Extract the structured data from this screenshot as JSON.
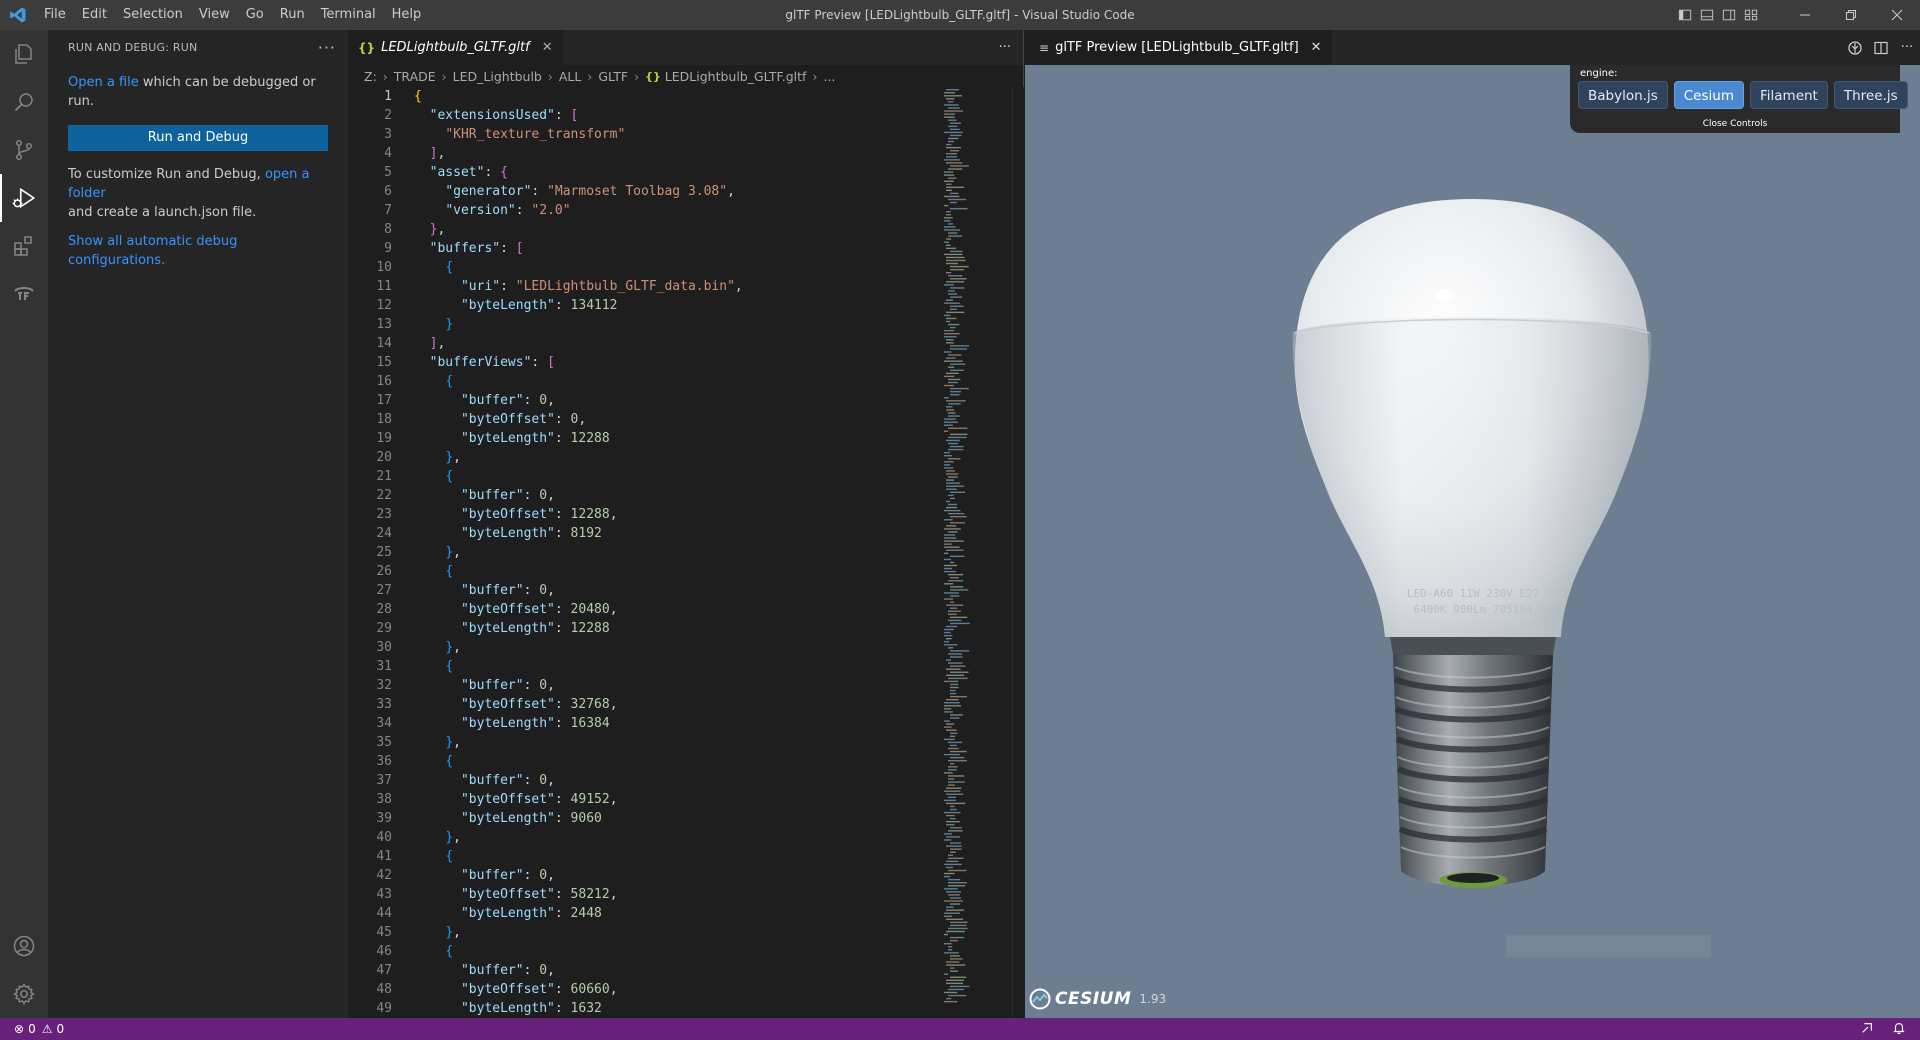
{
  "window": {
    "title": "glTF Preview [LEDLightbulb_GLTF.gltf] - Visual Studio Code"
  },
  "menu": [
    "File",
    "Edit",
    "Selection",
    "View",
    "Go",
    "Run",
    "Terminal",
    "Help"
  ],
  "sidebar": {
    "header": "RUN AND DEBUG: RUN",
    "open_file_link": "Open a file",
    "open_file_text": " which can be debugged or run.",
    "run_button": "Run and Debug",
    "customize_text": "To customize Run and Debug, ",
    "open_folder_link": "open a folder",
    "launch_text": "and create a launch.json file.",
    "show_all_link": "Show all automatic debug configurations."
  },
  "editor": {
    "tab_label": "LEDLightbulb_GLTF.gltf",
    "tab_icon": "{}",
    "breadcrumb": [
      "Z:",
      "TRADE",
      "LED_Lightbulb",
      "ALL",
      "GLTF",
      "LEDLightbulb_GLTF.gltf",
      "..."
    ],
    "current_line": 1
  },
  "preview": {
    "tab_label": "glTF Preview [LEDLightbulb_GLTF.gltf]",
    "engine_label": "engine:",
    "engines": [
      "Babylon.js",
      "Cesium",
      "Filament",
      "Three.js"
    ],
    "active_engine": "Cesium",
    "close_controls": "Close Controls",
    "cesium_word": "CESIUM",
    "cesium_version": "1.93",
    "bulb_text_line1": "LED-A60 11W 230V E27",
    "bulb_text_line2": "6400K 900Lm 705104"
  },
  "statusbar": {
    "errors": "0",
    "warnings": "0"
  },
  "colors": {
    "statusbar": "#68217a",
    "run_button": "#0e639c",
    "viewport_bg": "#6e7e92",
    "active_engine": "#4a88d0"
  }
}
